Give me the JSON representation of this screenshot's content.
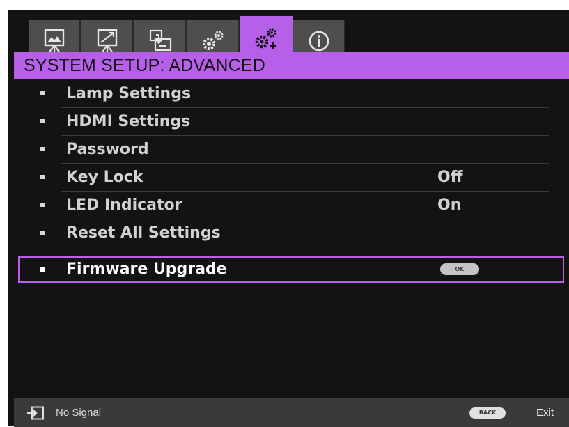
{
  "tabs": [
    {
      "icon": "picture-easel-icon",
      "active": false
    },
    {
      "icon": "easel-diagonal-icon",
      "active": false
    },
    {
      "icon": "source-display-icon",
      "active": false
    },
    {
      "icon": "gears-icon",
      "active": false
    },
    {
      "icon": "gears-plus-icon",
      "active": true
    },
    {
      "icon": "info-icon",
      "active": false
    }
  ],
  "title": "SYSTEM SETUP: ADVANCED",
  "menu": {
    "items": [
      {
        "label": "Lamp Settings",
        "value": ""
      },
      {
        "label": "HDMI Settings",
        "value": ""
      },
      {
        "label": "Password",
        "value": ""
      },
      {
        "label": "Key Lock",
        "value": "Off"
      },
      {
        "label": "LED Indicator",
        "value": "On"
      },
      {
        "label": "Reset All Settings",
        "value": ""
      },
      {
        "label": "Firmware Upgrade",
        "button": "OK",
        "selected": true
      }
    ]
  },
  "footer": {
    "source_icon": "input-source-icon",
    "status": "No Signal",
    "back_button": "BACK",
    "exit_label": "Exit"
  },
  "colors": {
    "accent": "#b660ea",
    "background": "#131313",
    "tab_inactive": "#4e4e4e",
    "footer": "#3a3a3a",
    "text": "#d2d2d2"
  }
}
